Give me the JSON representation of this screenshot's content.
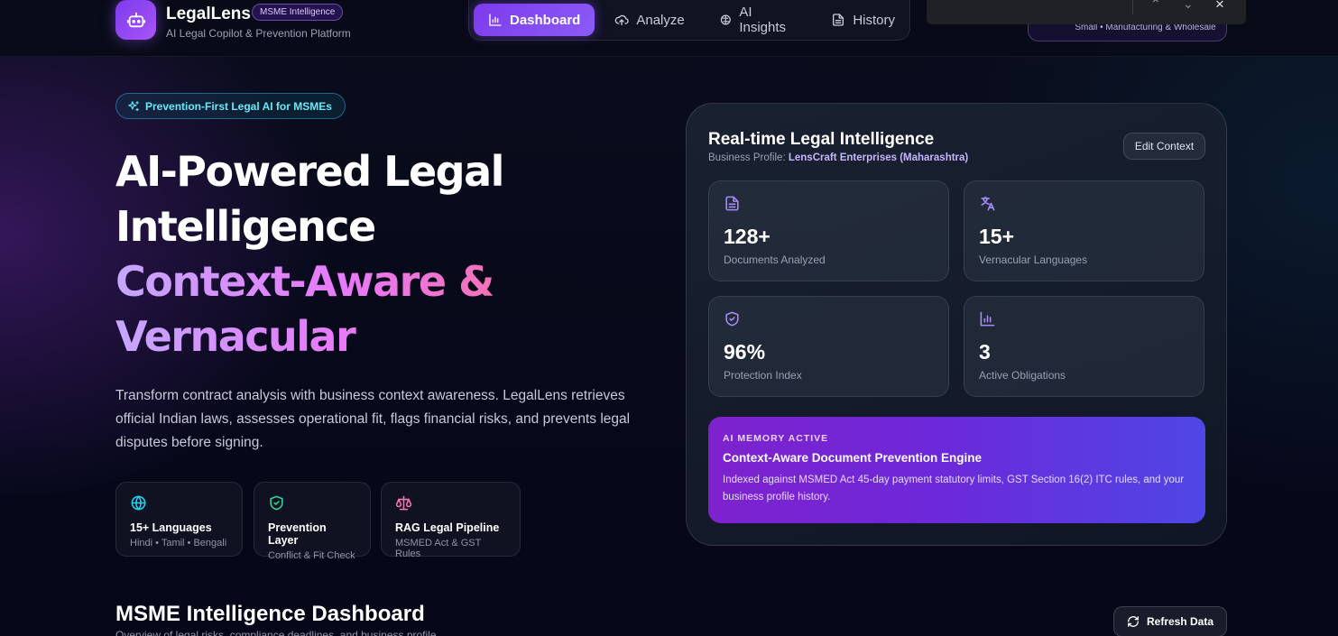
{
  "header": {
    "brand": "LegalLens",
    "badge": "MSME Intelligence",
    "tagline": "AI Legal Copilot & Prevention Platform",
    "nav": [
      {
        "label": "Dashboard",
        "icon": "bar-chart-icon",
        "active": true
      },
      {
        "label": "Analyze",
        "icon": "upload-cloud-icon",
        "active": false
      },
      {
        "label": "AI Insights",
        "icon": "brain-icon",
        "active": false
      },
      {
        "label": "History",
        "icon": "file-text-icon",
        "active": false
      }
    ],
    "profile_pill": "Small • Manufacturing & Wholesale"
  },
  "hero": {
    "badge": "Prevention-First Legal AI for MSMEs",
    "title_line1": "AI-Powered Legal",
    "title_line2": "Intelligence",
    "title_accent1": "Context-Aware &",
    "title_accent2": "Vernacular",
    "description": "Transform contract analysis with business context awareness. LegalLens retrieves official Indian laws, assesses operational fit, flags financial risks, and prevents legal disputes before signing.",
    "features": [
      {
        "title": "15+ Languages",
        "sub": "Hindi • Tamil • Bengali",
        "icon": "globe-icon"
      },
      {
        "title": "Prevention Layer",
        "sub": "Conflict & Fit Check",
        "icon": "shield-check-icon"
      },
      {
        "title": "RAG Legal Pipeline",
        "sub": "MSMED Act & GST Rules",
        "icon": "scale-icon"
      }
    ]
  },
  "panel": {
    "title": "Real-time Legal Intelligence",
    "profile_label": "Business Profile: ",
    "profile_value": "LensCraft Enterprises (Maharashtra)",
    "edit_label": "Edit Context",
    "stats": [
      {
        "value": "128+",
        "label": "Documents Analyzed",
        "icon": "document-icon"
      },
      {
        "value": "15+",
        "label": "Vernacular Languages",
        "icon": "translate-icon"
      },
      {
        "value": "96%",
        "label": "Protection Index",
        "icon": "shield-icon"
      },
      {
        "value": "3",
        "label": "Active Obligations",
        "icon": "bar-chart-icon"
      }
    ],
    "memory": {
      "tag": "AI MEMORY ACTIVE",
      "title": "Context-Aware Document Prevention Engine",
      "text": "Indexed against MSMED Act 45-day payment statutory limits, GST Section 16(2) ITC rules, and your business profile history."
    }
  },
  "dashboard": {
    "title": "MSME Intelligence Dashboard",
    "subtitle": "Overview of legal risks, compliance deadlines, and business profile",
    "refresh_label": "Refresh Data"
  },
  "colors": {
    "accent": "#7c3aed",
    "cyan": "#22d3ee",
    "green": "#34d399",
    "pink": "#f472b6"
  }
}
